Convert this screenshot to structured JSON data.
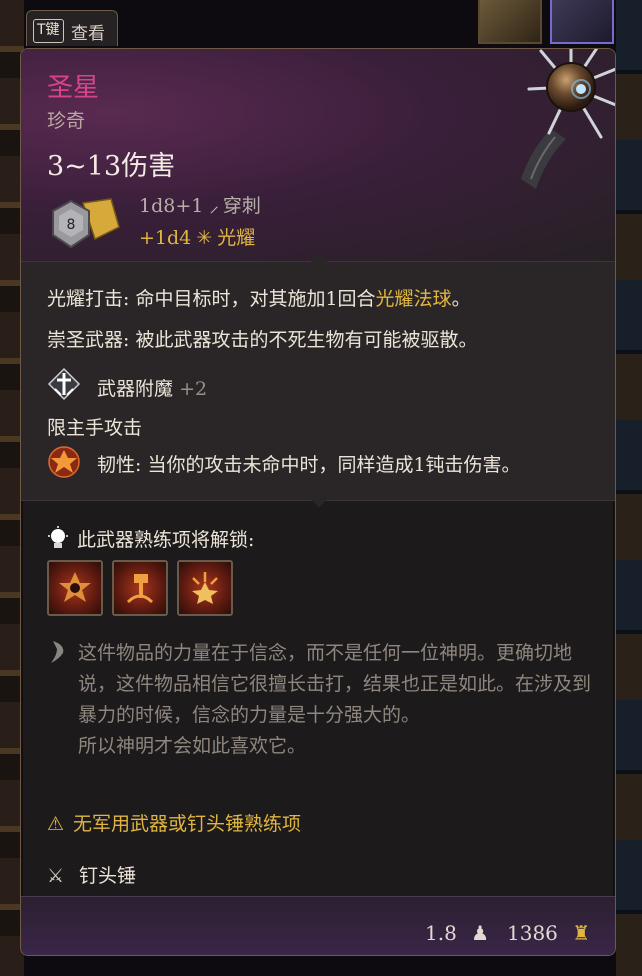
{
  "tab": {
    "key": "T键",
    "label": "查看"
  },
  "item": {
    "name": "圣星",
    "rarity": "珍奇",
    "damage_total": "3~13伤害",
    "damage_lines": [
      {
        "dice": "1d8+1",
        "type": "穿刺",
        "icon": "piercing-icon"
      },
      {
        "dice": "+1d4",
        "type": "光耀",
        "icon": "radiant-icon"
      }
    ],
    "dice_badge": "8"
  },
  "properties": {
    "radiant_strike": {
      "label": "光耀打击:",
      "text_a": " 命中目标时，对其施加1回合",
      "highlight": "光耀法球",
      "text_b": "。"
    },
    "holy_weapon": {
      "label": "崇圣武器:",
      "text": " 被此武器攻击的不死生物有可能被驱散。"
    },
    "enchant": {
      "label": "武器附魔",
      "bonus": "+2"
    },
    "main_hand": "限主手攻击",
    "toughness": {
      "label": "韧性:",
      "text": " 当你的攻击未命中时，同样造成1钝击伤害。"
    }
  },
  "proficiency": {
    "title": "此武器熟练项将解锁:",
    "actions": [
      {
        "icon": "action-icon-1"
      },
      {
        "icon": "action-icon-2"
      },
      {
        "icon": "action-icon-3"
      }
    ]
  },
  "description": {
    "para1": "这件物品的力量在于信念，而不是任何一位神明。更确切地说，这件物品相信它很擅长击打，结果也正是如此。在涉及到暴力的时候，信念的力量是十分强大的。",
    "para2": "所以神明才会如此喜欢它。"
  },
  "warning": "无军用武器或钉头锤熟练项",
  "weapon_type": "钉头锤",
  "stats": {
    "weight": "1.8",
    "value": "1386"
  },
  "colors": {
    "name": "#d9438a",
    "highlight": "#e0b640",
    "text": "#ece4d8",
    "muted": "#8f867e"
  }
}
